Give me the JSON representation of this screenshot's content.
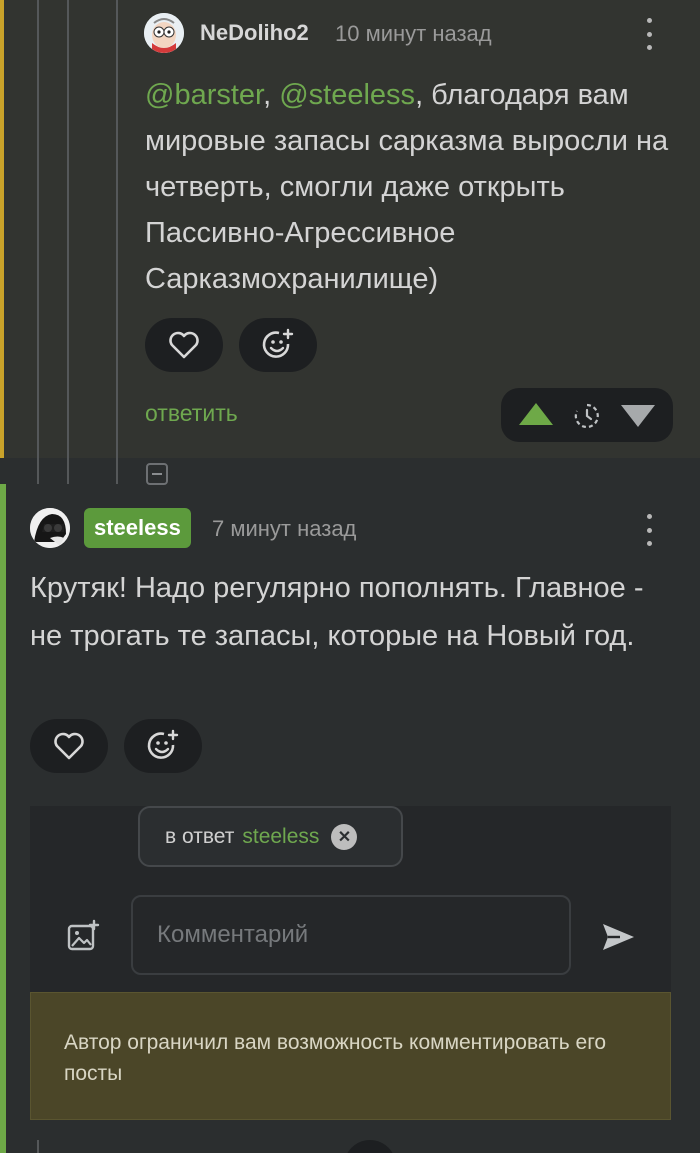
{
  "parent_comment": {
    "author": "NeDoliho2",
    "time": "10 минут назад",
    "mentions": [
      "@barster",
      "@steeless"
    ],
    "text_after_mentions": ", благодаря вам мировые запасы сарказма выросли на четверть, смогли даже открыть Пассивно-Агрессивное Сарказмохранилище)",
    "separator": ", ",
    "reply_label": "ответить",
    "icons": {
      "like": "heart-icon",
      "react": "emoji-add-icon",
      "upvote": "arrow-up-icon",
      "timer": "clock-icon",
      "downvote": "arrow-down-icon",
      "menu": "kebab-menu-icon"
    },
    "accent_color": "#c9a22a"
  },
  "reply_comment": {
    "author": "steeless",
    "time": "7 минут назад",
    "text": "Крутяк! Надо регулярно пополнять. Главное - не трогать те запасы, которые на Новый год.",
    "accent_color": "#6ea947",
    "icons": {
      "like": "heart-icon",
      "react": "emoji-add-icon",
      "menu": "kebab-menu-icon",
      "collapse": "collapse-minus-icon"
    }
  },
  "reply_form": {
    "reply_to_prefix": "в ответ",
    "reply_to_name": "steeless",
    "close_glyph": "✕",
    "placeholder": "Комментарий",
    "warning": "Автор ограничил вам возможность комментировать его посты",
    "icons": {
      "attach": "add-image-icon",
      "send": "send-icon"
    }
  },
  "colors": {
    "link_green": "#6fa84f",
    "background": "#2b2e2f",
    "warning_bg": "#4b4628"
  }
}
